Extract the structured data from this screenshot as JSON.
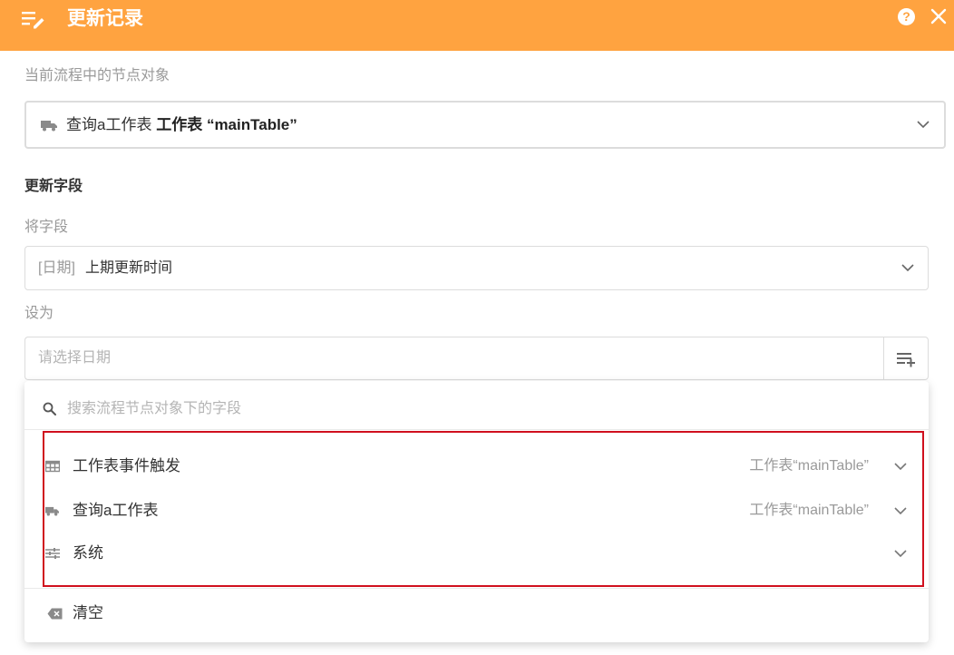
{
  "header": {
    "title": "更新记录",
    "menu_icon": "edit-list-icon",
    "help_glyph": "?",
    "accent": "#ffa340"
  },
  "node_section": {
    "label": "当前流程中的节点对象",
    "selected": {
      "prefix": "查询a工作表",
      "bold": "工作表",
      "name": "“mainTable”",
      "icon": "truck-icon"
    }
  },
  "update_fields": {
    "title": "更新字段",
    "field_label": "将字段",
    "field_tag": "[日期]",
    "field_value": "上期更新时间",
    "set_label": "设为",
    "date_placeholder": "请选择日期"
  },
  "dropdown": {
    "search_placeholder": "搜索流程节点对象下的字段",
    "items": [
      {
        "label": "工作表事件触发",
        "source": "工作表“mainTable”",
        "icon": "table-icon"
      },
      {
        "label": "查询a工作表",
        "source": "工作表“mainTable”",
        "icon": "truck-icon"
      },
      {
        "label": "系统",
        "source": "",
        "icon": "sliders-icon"
      }
    ],
    "clear_label": "清空",
    "highlight_color": "#d0101e"
  }
}
